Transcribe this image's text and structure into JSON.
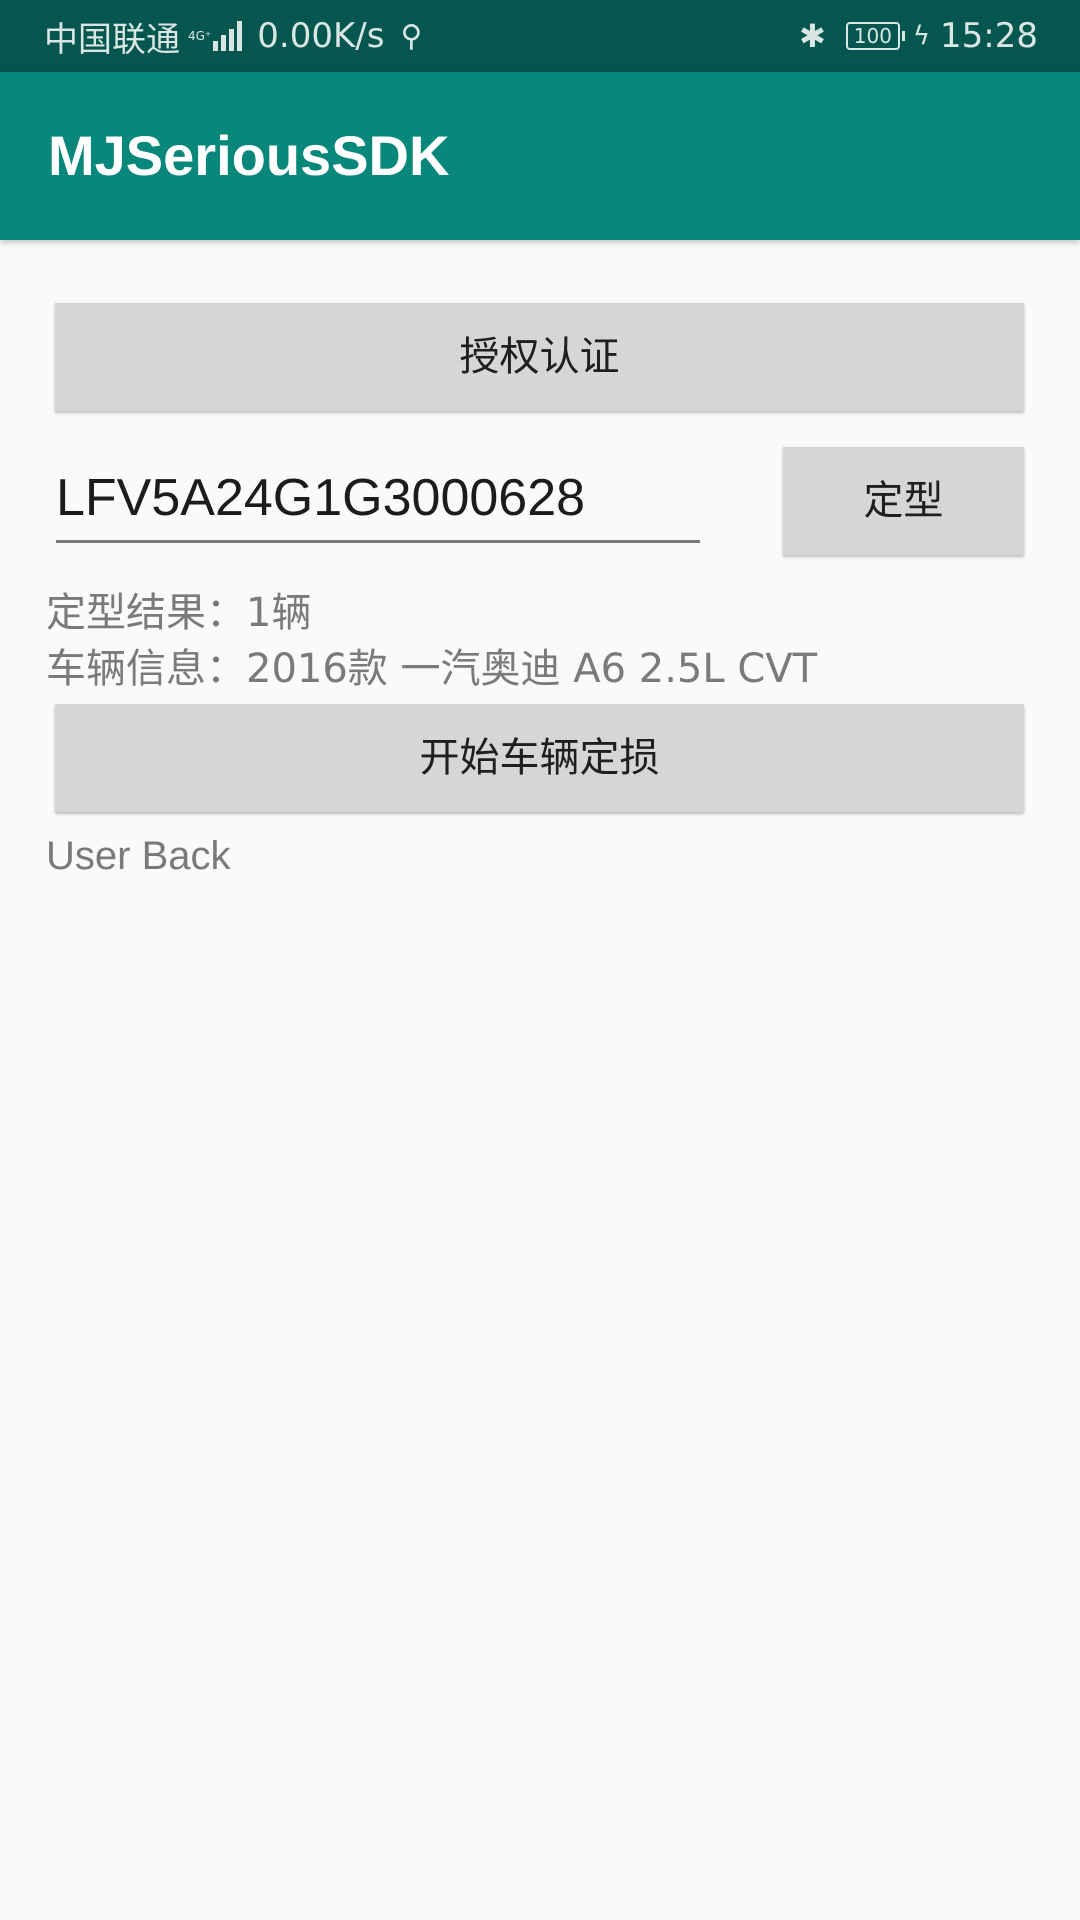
{
  "status_bar": {
    "carrier": "中国联通",
    "network_type": "4G⁺",
    "speed": "0.00K/s",
    "bluetooth_icon": "bluetooth-icon",
    "battery": "100",
    "time": "15:28"
  },
  "app_bar": {
    "title": "MJSeriousSDK",
    "background_color": "#08877a"
  },
  "main": {
    "auth_button_label": "授权认证",
    "vin_value": "LFV5A24G1G3000628",
    "type_button_label": "定型",
    "type_result": "定型结果：1辆",
    "vehicle_info": "车辆信息：2016款 一汽奥迪 A6 2.5L CVT",
    "start_button_label": "开始车辆定损",
    "user_back": "User Back"
  }
}
